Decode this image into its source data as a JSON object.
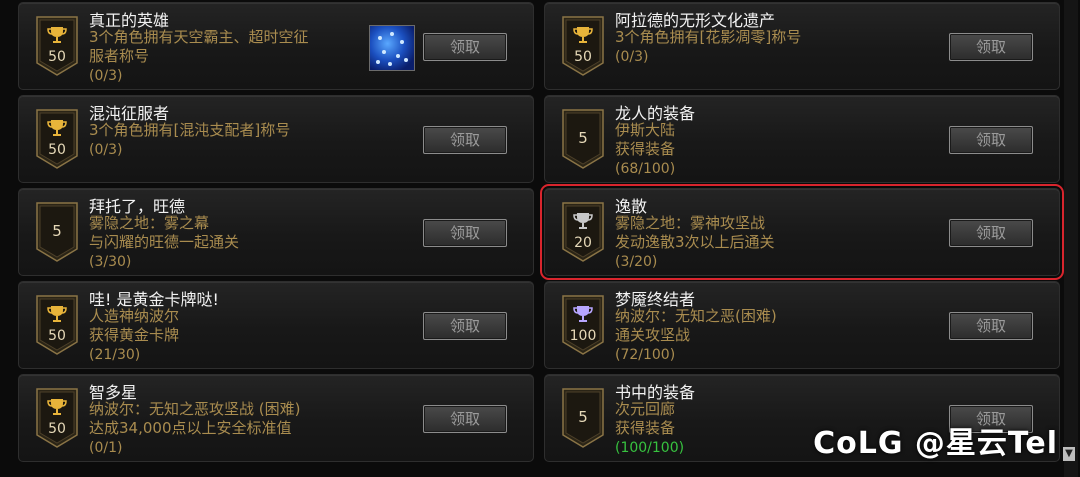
{
  "colors": {
    "progress_text": "#a98c4f",
    "progress_done": "#37c23f",
    "highlight": "#d9252d",
    "gold_cup": "#e8b43a",
    "silver_cup": "#c8c8c8",
    "purple_cup": "#b7a6ff"
  },
  "button_label": "领取",
  "cards": [
    {
      "title": "真正的英雄",
      "desc": [
        "3个角色拥有天空霸主、超时空征",
        "服者称号"
      ],
      "progress": "(0/3)",
      "points": "50",
      "cup": "gold",
      "has_item": true
    },
    {
      "title": "阿拉德的无形文化遗产",
      "desc": [
        "3个角色拥有[花影凋零]称号"
      ],
      "progress": "(0/3)",
      "points": "50",
      "cup": "gold"
    },
    {
      "title": "混沌征服者",
      "desc": [
        "3个角色拥有[混沌支配者]称号"
      ],
      "progress": "(0/3)",
      "points": "50",
      "cup": "gold"
    },
    {
      "title": "龙人的装备",
      "desc": [
        "伊斯大陆",
        "获得装备"
      ],
      "progress": "(68/100)",
      "points": "5",
      "cup": "none"
    },
    {
      "title": "拜托了，旺德",
      "desc": [
        "雾隐之地：雾之幕",
        "与闪耀的旺德一起通关"
      ],
      "progress": "(3/30)",
      "points": "5",
      "cup": "none"
    },
    {
      "title": "逸散",
      "desc": [
        "雾隐之地：雾神攻坚战",
        "发动逸散3次以上后通关"
      ],
      "progress": "(3/20)",
      "points": "20",
      "cup": "silver",
      "highlight": true
    },
    {
      "title": "哇! 是黄金卡牌哒!",
      "desc": [
        "人造神纳波尔",
        "获得黄金卡牌"
      ],
      "progress": "(21/30)",
      "points": "50",
      "cup": "gold"
    },
    {
      "title": "梦魇终结者",
      "desc": [
        "纳波尔：无知之恶(困难)",
        "通关攻坚战"
      ],
      "progress": "(72/100)",
      "points": "100",
      "cup": "purple"
    },
    {
      "title": "智多星",
      "desc": [
        "纳波尔：无知之恶攻坚战 (困难)",
        "达成34,000点以上安全标准值"
      ],
      "progress": "(0/1)",
      "points": "50",
      "cup": "gold"
    },
    {
      "title": "书中的装备",
      "desc": [
        "次元回廊",
        "获得装备"
      ],
      "progress": "(100/100)",
      "points": "5",
      "cup": "none",
      "done": true
    }
  ],
  "watermark": "CoLG @星云Tel",
  "scroll_arrow": "▼"
}
